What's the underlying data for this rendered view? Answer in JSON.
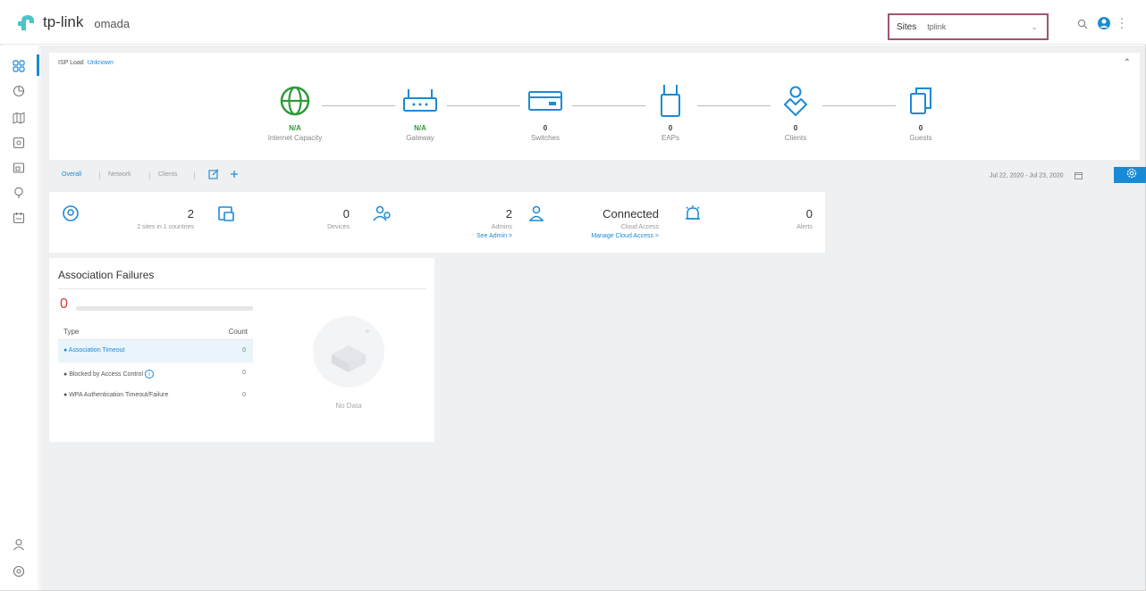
{
  "brand": {
    "logo": "tp-link",
    "product": "omada"
  },
  "sites": {
    "label": "Sites",
    "value": "tplink"
  },
  "colors": {
    "accent": "#1a8ad6",
    "internet_green": "#2e9a3a",
    "alert_red": "#d23c3c",
    "sites_border": "#a0566a"
  },
  "rail": {
    "items": [
      {
        "icon": "dashboard-icon"
      },
      {
        "icon": "statistics-icon"
      },
      {
        "icon": "map-icon"
      },
      {
        "icon": "devices-icon"
      },
      {
        "icon": "logs-icon"
      },
      {
        "icon": "location-icon"
      },
      {
        "icon": "calendar-icon"
      },
      {
        "icon": "account-icon"
      },
      {
        "icon": "settings-icon"
      }
    ]
  },
  "topology": {
    "isp_label": "ISP Load",
    "isp_status": "Unknown",
    "nodes": [
      {
        "value": "N/A",
        "label": "Internet Capacity",
        "icon": "globe-icon"
      },
      {
        "value": "N/A",
        "label": "Gateway",
        "icon": "router-icon"
      },
      {
        "value": "0",
        "label": "Switches",
        "icon": "switch-icon"
      },
      {
        "value": "0",
        "label": "EAPs",
        "icon": "access-point-icon"
      },
      {
        "value": "0",
        "label": "Clients",
        "icon": "clients-icon"
      },
      {
        "value": "0",
        "label": "Guests",
        "icon": "guests-icon"
      }
    ]
  },
  "tabs": {
    "overall": "Overall",
    "network": "Network",
    "clients": "Clients"
  },
  "date_range": {
    "start": "Jul 22, 2020",
    "end": "Jul 23, 2020"
  },
  "stats": {
    "sites": {
      "value": "2",
      "sub": "2 sites in 1 countries"
    },
    "devices": {
      "value": "0",
      "sub": "Devices"
    },
    "admins": {
      "value": "2",
      "sub": "Admins",
      "link": "See Admin >"
    },
    "cloud": {
      "value": "Connected",
      "sub": "Cloud Access",
      "link": "Manage Cloud Access >"
    },
    "alerts": {
      "value": "0",
      "sub": "Alerts"
    }
  },
  "assoc": {
    "title": "Association Failures",
    "total": "0",
    "col_type": "Type",
    "col_count": "Count",
    "rows": [
      {
        "type": "Association Timeout",
        "count": "0"
      },
      {
        "type": "Blocked by Access Control",
        "count": "0"
      },
      {
        "type": "WPA Authentication Timeout/Failure",
        "count": "0"
      }
    ],
    "nodata": "No Data"
  }
}
